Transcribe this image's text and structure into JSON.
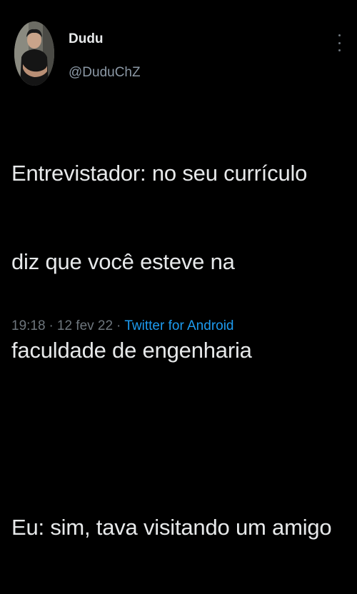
{
  "tweet": {
    "author": {
      "display_name": "Dudu",
      "handle": "@DuduChZ",
      "avatar": "profile-photo"
    },
    "more_icon": "more-vertical-icon",
    "text_lines": [
      "Entrevistador: no seu currículo",
      "diz que você esteve na",
      "faculdade de engenharia",
      "",
      "Eu: sim, tava visitando um amigo"
    ],
    "time": "19:18",
    "separator": "·",
    "date": "12 fev 22",
    "source": "Twitter for Android"
  },
  "colors": {
    "background": "#000000",
    "text": "#e7e9ea",
    "muted": "#6e767d",
    "handle": "#8b98a5",
    "link": "#1d9bf0"
  }
}
